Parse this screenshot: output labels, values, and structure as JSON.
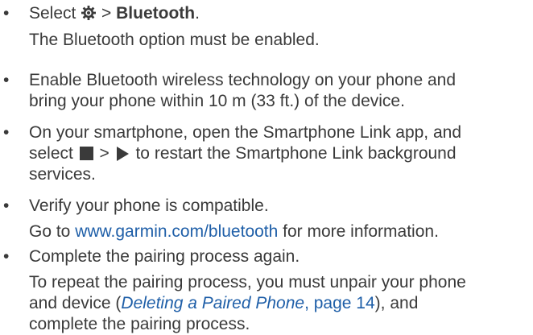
{
  "bullet_char": "•",
  "items": [
    {
      "step_before_icon": "Select ",
      "step_after_icon": " > ",
      "step_bold": "Bluetooth",
      "step_end": ".",
      "note": "The Bluetooth option must be enabled."
    },
    {
      "line1": "Enable Bluetooth wireless technology on your phone and",
      "line2": "bring your phone within 10 m (33 ft.) of the device."
    },
    {
      "line1": "On your smartphone, open the Smartphone Link app, and",
      "line2_a": "select ",
      "line2_b": " > ",
      "line2_c": " to restart the Smartphone Link background",
      "line3": "services."
    },
    {
      "step": "Verify your phone is compatible.",
      "note_a": "Go to ",
      "note_link": "www.garmin.com/bluetooth",
      "note_b": " for more information."
    },
    {
      "step": "Complete the pairing process again.",
      "note_line1": "To repeat the pairing process, you must unpair your phone",
      "note_line2_a": "and device (",
      "note_xref": "Deleting a Paired Phone",
      "note_page": ", page 14",
      "note_line2_b": "), and",
      "note_line3": "complete the pairing process."
    }
  ],
  "icons": {
    "settings": "gear-icon",
    "menu": "square-menu-icon",
    "play": "play-icon"
  }
}
